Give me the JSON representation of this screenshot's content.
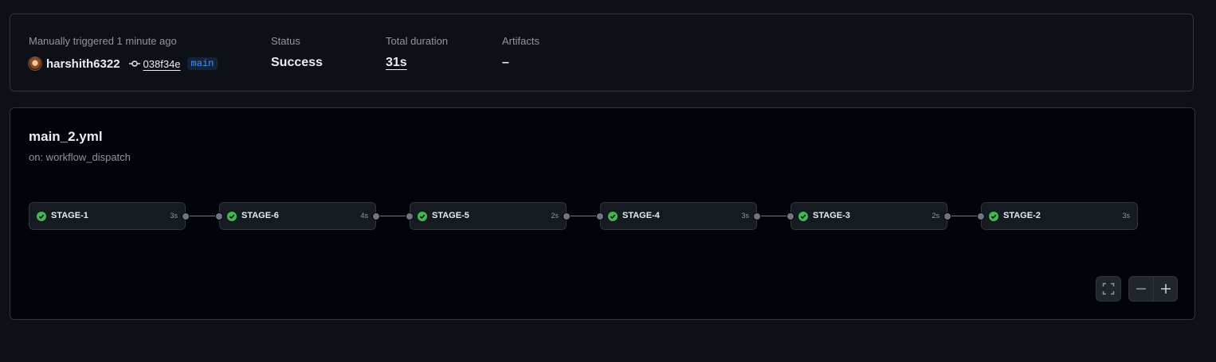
{
  "summary": {
    "trigger_label": "Manually triggered 1 minute ago",
    "username": "harshith6322",
    "commit_sha": "038f34e",
    "branch": "main",
    "status_label": "Status",
    "status_value": "Success",
    "duration_label": "Total duration",
    "duration_value": "31s",
    "artifacts_label": "Artifacts",
    "artifacts_value": "–"
  },
  "workflow": {
    "file": "main_2.yml",
    "trigger": "on: workflow_dispatch",
    "jobs": [
      {
        "name": "STAGE-1",
        "duration": "3s",
        "status": "success"
      },
      {
        "name": "STAGE-6",
        "duration": "4s",
        "status": "success"
      },
      {
        "name": "STAGE-5",
        "duration": "2s",
        "status": "success"
      },
      {
        "name": "STAGE-4",
        "duration": "3s",
        "status": "success"
      },
      {
        "name": "STAGE-3",
        "duration": "2s",
        "status": "success"
      },
      {
        "name": "STAGE-2",
        "duration": "3s",
        "status": "success"
      }
    ]
  },
  "controls": {
    "fullscreen_icon": "fullscreen-icon",
    "zoom_out_icon": "minus-icon",
    "zoom_in_icon": "plus-icon"
  },
  "colors": {
    "success": "#3fb950",
    "link": "#4493f8",
    "background": "#0d1117",
    "canvas": "#010409"
  }
}
